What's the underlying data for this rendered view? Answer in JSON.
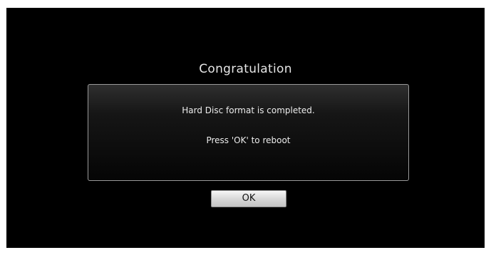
{
  "dialog": {
    "title": "Congratulation",
    "message_line1": "Hard Disc format is completed.",
    "message_line2": "Press 'OK' to reboot",
    "ok_label": "OK"
  },
  "colors": {
    "background": "#000000",
    "border": "#9a9a9a",
    "text": "#ececec",
    "button_face": "#d8d8d8"
  }
}
